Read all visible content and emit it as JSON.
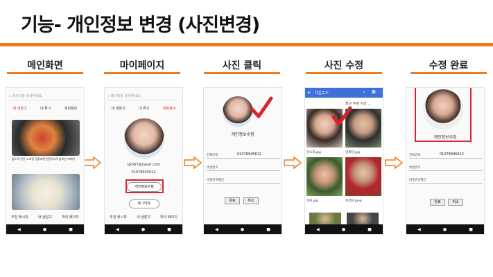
{
  "title": "기능- 개인정보 변경 (사진변경)",
  "steps": [
    {
      "label": "메인화면"
    },
    {
      "label": "마이페이지"
    },
    {
      "label": "사진 클릭"
    },
    {
      "label": "사진 수정"
    },
    {
      "label": "수정 완료"
    }
  ],
  "main_screen": {
    "search_placeholder": "레시피를 검색하세요.",
    "tabs": [
      "내 냉장고",
      "내 튜기",
      "회원정보"
    ],
    "card1_caption": "밥도둑 반찬 소포장 집중포함 반응이다V 밥보판 보배기",
    "bottom_tabs": [
      "추천 레시피",
      "내 냉장고",
      "마이 페이지"
    ]
  },
  "my_page": {
    "search_placeholder": "레시피를 검색하세요.",
    "tabs": [
      "내 냉장고",
      "내 튜기",
      "회원정보"
    ],
    "email": "sjk567@naver.com",
    "phone": "01078945612",
    "edit_button": "개인정보수정",
    "logout_button": "로그아웃",
    "bottom_tabs": [
      "추천 레시피",
      "내 냉장고",
      "마이 페이지"
    ]
  },
  "photo_click": {
    "heading": "개인정보수정",
    "fields": [
      {
        "label": "전화번호",
        "value": "01078945612"
      },
      {
        "label": "비밀번호",
        "value": ""
      },
      {
        "label": "비밀번호확인",
        "value": ""
      }
    ],
    "confirm": "완료",
    "cancel": "취소"
  },
  "photo_edit": {
    "app_bar_title": "다운로드",
    "sort_label": "최근 수정 시간",
    "photos": [
      {
        "name": "한소희.jpg",
        "meta": "82.34KB 7월 28일"
      },
      {
        "name": "양세찬.jpg",
        "meta": "52.87KB 7월 28일"
      },
      {
        "name": "하하.jpg",
        "meta": "47.08KB 7월 28일"
      },
      {
        "name": "지석진.jpeg",
        "meta": "38.89KB 7월 28일"
      }
    ]
  },
  "edit_done": {
    "heading": "개인정보수정",
    "fields": [
      {
        "label": "전화번호",
        "value": "01078945612"
      },
      {
        "label": "비밀번호",
        "value": ""
      },
      {
        "label": "비밀번호확인",
        "value": ""
      }
    ],
    "confirm": "완료",
    "cancel": "취소"
  },
  "colors": {
    "accent": "#f07a19",
    "highlight": "#d9232d",
    "app_bar": "#3f6fd8"
  }
}
